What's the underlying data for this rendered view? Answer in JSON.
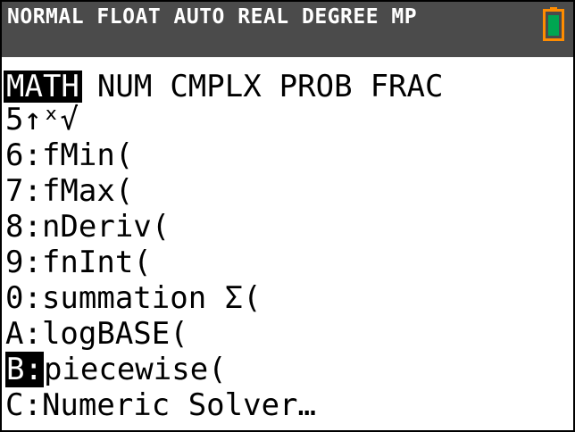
{
  "status_bar": {
    "text": "NORMAL FLOAT AUTO REAL DEGREE MP",
    "battery_color": "#ff8c00",
    "battery_fill_color": "#00a651"
  },
  "menu": {
    "tabs": [
      {
        "label": "MATH",
        "selected": true
      },
      {
        "label": "NUM",
        "selected": false
      },
      {
        "label": "CMPLX",
        "selected": false
      },
      {
        "label": "PROB",
        "selected": false
      },
      {
        "label": "FRAC",
        "selected": false
      }
    ],
    "items": [
      {
        "key": "5↑",
        "label": "ˣ√",
        "selected": false
      },
      {
        "key": "6:",
        "label": "fMin(",
        "selected": false
      },
      {
        "key": "7:",
        "label": "fMax(",
        "selected": false
      },
      {
        "key": "8:",
        "label": "nDeriv(",
        "selected": false
      },
      {
        "key": "9:",
        "label": "fnInt(",
        "selected": false
      },
      {
        "key": "0:",
        "label": "summation Σ(",
        "selected": false
      },
      {
        "key": "A:",
        "label": "logBASE(",
        "selected": false
      },
      {
        "key": "B:",
        "label": "piecewise(",
        "selected": true
      },
      {
        "key": "C:",
        "label": "Numeric Solver…",
        "selected": false
      }
    ]
  }
}
